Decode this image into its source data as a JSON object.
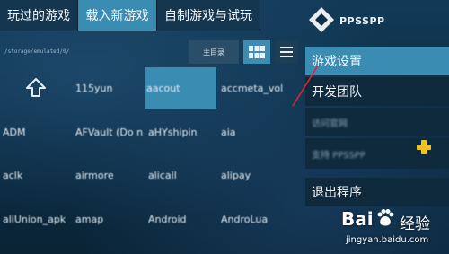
{
  "tabs": [
    {
      "label": "玩过的游戏"
    },
    {
      "label": "载入新游戏"
    },
    {
      "label": "自制游戏与试玩"
    }
  ],
  "path": "/storage/emulated/0/",
  "toolbar": {
    "home_label": "主目录"
  },
  "icons": [
    "grid-view-icon",
    "list-view-icon",
    "up-arrow-icon",
    "ppsspp-logo-icon",
    "ppsspp-mini-icon",
    "baidu-paw-icon"
  ],
  "files": [
    {
      "label": ""
    },
    {
      "label": "115yun"
    },
    {
      "label": "aacout"
    },
    {
      "label": "accmeta_vol"
    },
    {
      "label": "ADM"
    },
    {
      "label": "AFVault (Do n"
    },
    {
      "label": "aHYshipin"
    },
    {
      "label": "aia"
    },
    {
      "label": "aclk"
    },
    {
      "label": "airmore"
    },
    {
      "label": "alicall"
    },
    {
      "label": "alipay"
    },
    {
      "label": "aliUnion_apk"
    },
    {
      "label": "amap"
    },
    {
      "label": "Android"
    },
    {
      "label": "AndroLua"
    }
  ],
  "logo": {
    "text": "PPSSPP"
  },
  "menu": {
    "items": [
      {
        "label": "游戏设置"
      },
      {
        "label": "开发团队"
      },
      {
        "label": "访问官网"
      },
      {
        "label": "支持 PPSSPP"
      },
      {
        "label": "退出程序"
      }
    ]
  },
  "watermark": {
    "brand": "Bai",
    "cn": "经验",
    "url": "jingyan.baidu.com"
  },
  "colors": {
    "accent": "#3b8cb3",
    "background": "#0c2d44",
    "annotation": "#e0252e"
  }
}
